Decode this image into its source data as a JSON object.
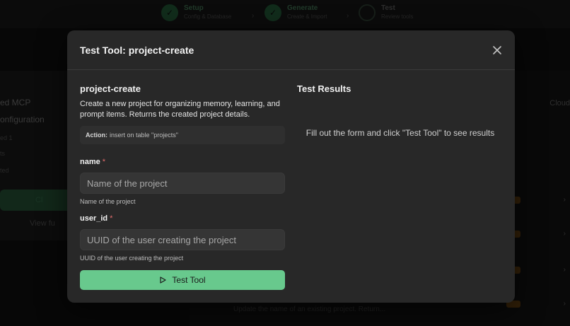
{
  "modal": {
    "title": "Test Tool: project-create",
    "tool_name": "project-create",
    "description": "Create a new project for organizing memory, learning, and prompt items. Returns the created project details.",
    "action_label": "Action:",
    "action_value": "insert on table \"projects\"",
    "fields": [
      {
        "label": "name",
        "required": "*",
        "placeholder": "Name of the project",
        "help": "Name of the project"
      },
      {
        "label": "user_id",
        "required": "*",
        "placeholder": "UUID of the user creating the project",
        "help": "UUID of the user creating the project"
      }
    ],
    "test_button": "Test Tool",
    "results_title": "Test Results",
    "results_empty": "Fill out the form and click \"Test Tool\" to see results"
  },
  "background": {
    "steps": [
      {
        "title": "Setup",
        "subtitle": "Config & Database"
      },
      {
        "title": "Generate",
        "subtitle": "Create & Import"
      },
      {
        "title": "Test",
        "subtitle": "Review tools"
      }
    ],
    "left_title": "ed MCP\nonfiguration",
    "left_meta": [
      "ed 1",
      "ts",
      "ted"
    ],
    "left_button": "Cl",
    "left_link": "View fu",
    "right_tag": "Cloud",
    "row_text": "Update the name of an existing project. Return..."
  },
  "colors": {
    "accent": "#68c98d",
    "modal_bg": "#282828",
    "required": "#e06c6c"
  }
}
